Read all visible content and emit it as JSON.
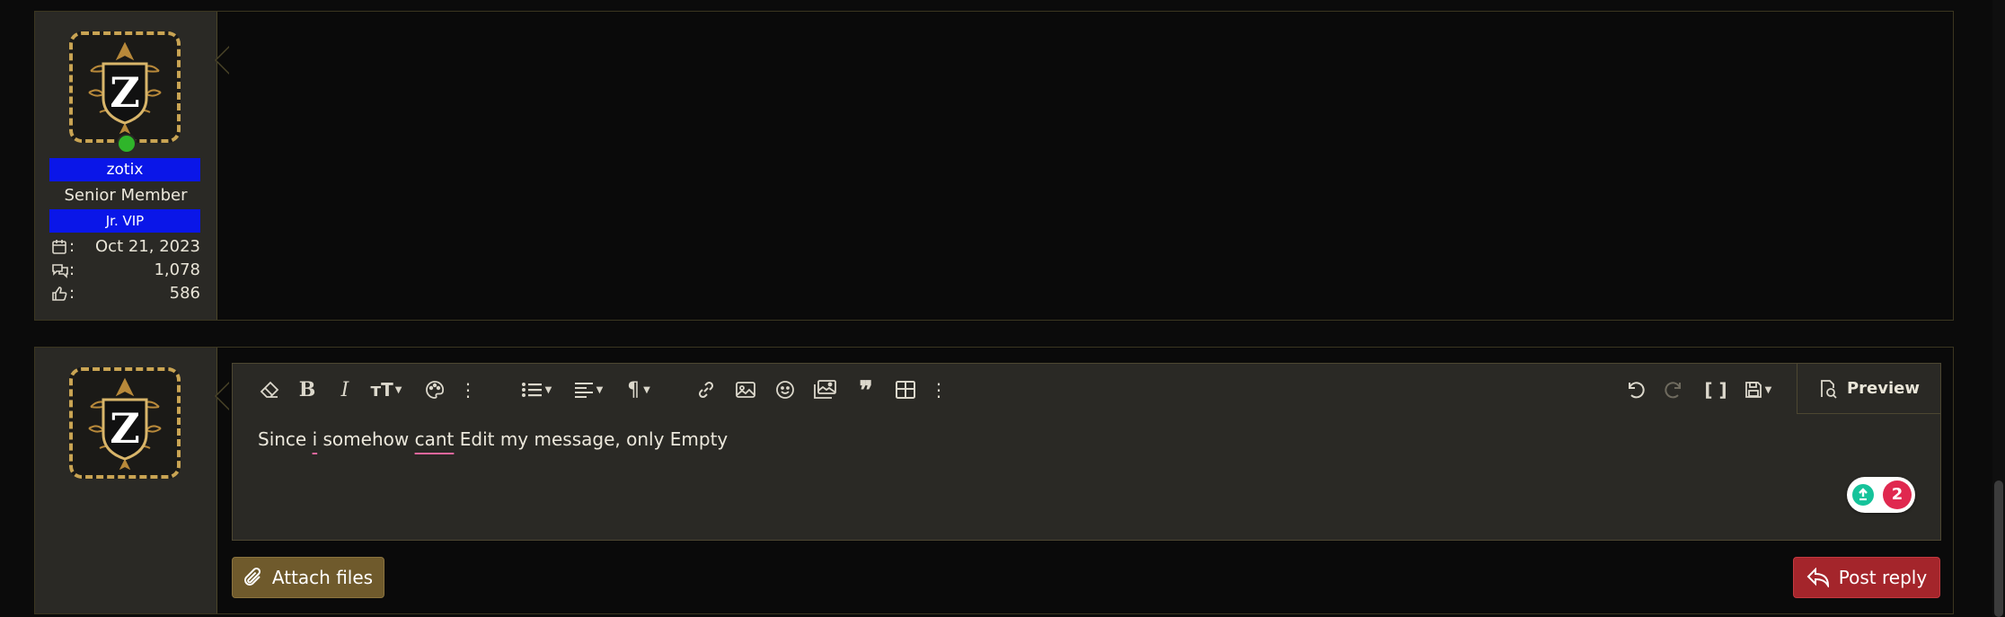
{
  "post1": {
    "username": "zotix",
    "user_title": "Senior Member",
    "user_badge": "Jr. VIP",
    "avatar_letter": "Z",
    "stats": [
      {
        "icon": "calendar-icon",
        "colon": ":",
        "value": "Oct 21, 2023"
      },
      {
        "icon": "messages-icon",
        "colon": ":",
        "value": "1,078"
      },
      {
        "icon": "thumbs-up-icon",
        "colon": ":",
        "value": "586"
      }
    ]
  },
  "reply_form": {
    "avatar_letter": "Z",
    "editor_text_parts": [
      "Since ",
      "i",
      " somehow ",
      "cant",
      " Edit my message, only Empty"
    ],
    "preview_label": "Preview",
    "grammarly_count": "2",
    "attach_label": "Attach files",
    "post_reply_label": "Post reply"
  },
  "toolbar_icons": [
    "eraser-icon",
    "bold-icon",
    "italic-icon",
    "text-size-icon",
    "palette-icon",
    "more-vertical-icon",
    "list-icon",
    "align-icon",
    "paragraph-icon",
    "link-icon",
    "image-icon",
    "smile-icon",
    "media-icon",
    "quote-icon",
    "table-icon",
    "more-vertical-icon",
    "undo-icon",
    "redo-icon",
    "brackets-icon",
    "save-draft-icon"
  ],
  "colors": {
    "user_banner": "#0a16e8",
    "attach_button": "#6f5a2c",
    "post_reply_button": "#a4252b",
    "avatar_border": "#c9a453",
    "online_dot": "#2fb52a"
  }
}
